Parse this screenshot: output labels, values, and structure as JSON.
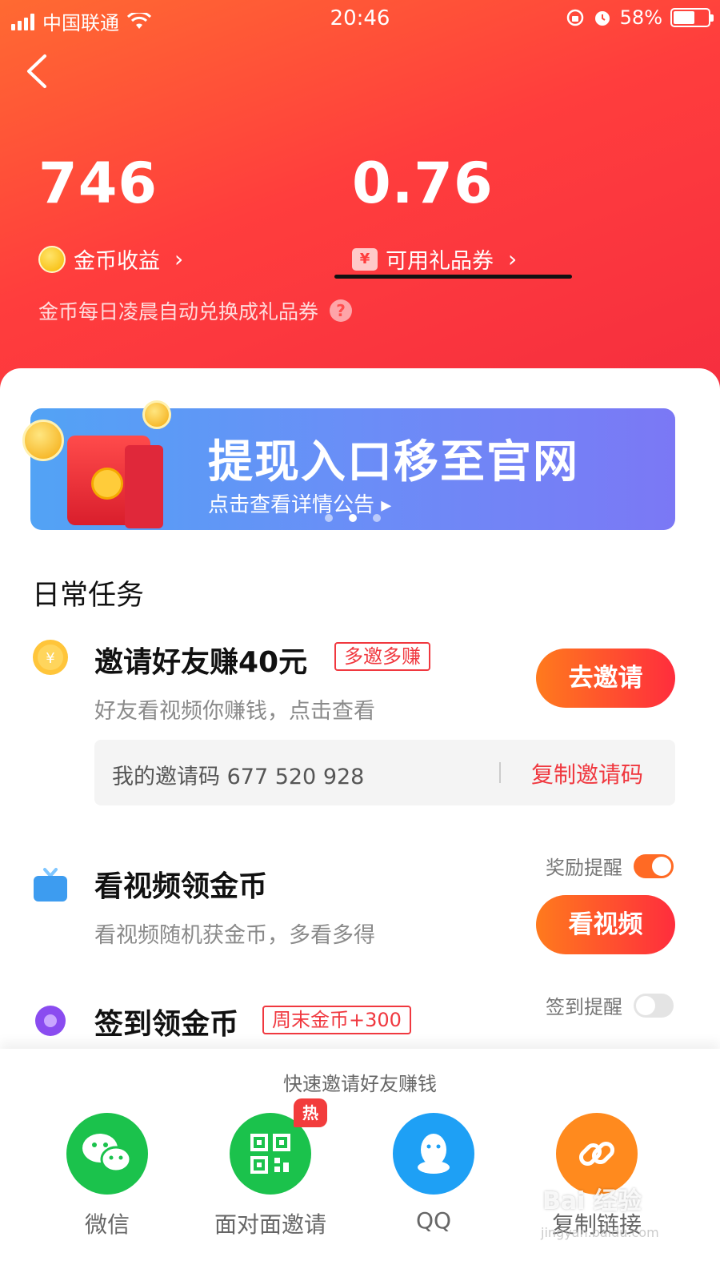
{
  "status_bar": {
    "carrier": "中国联通",
    "time": "20:46",
    "battery": "58%"
  },
  "header": {
    "coins": {
      "value": "746",
      "label": "金币收益"
    },
    "vouchers": {
      "value": "0.76",
      "label": "可用礼品券",
      "icon_text": "¥"
    },
    "hint": "金币每日凌晨自动兑换成礼品券",
    "hint_icon": "?"
  },
  "banner": {
    "title": "提现入口移至官网",
    "subtitle": "点击查看详情公告"
  },
  "tasks_section": {
    "title": "日常任务"
  },
  "tasks": {
    "invite": {
      "title": "邀请好友赚40元",
      "tag": "多邀多赚",
      "desc": "好友看视频你赚钱，点击查看",
      "button": "去邀请",
      "icon_text": "¥",
      "code_label": "我的邀请码 677 520 928",
      "copy": "复制邀请码"
    },
    "video": {
      "title": "看视频领金币",
      "desc": "看视频随机获金币，多看多得",
      "button": "看视频",
      "remind_label": "奖励提醒",
      "remind_on": true
    },
    "checkin": {
      "title": "签到领金币",
      "tag": "周末金币+300",
      "remind_label": "签到提醒",
      "remind_on": false
    }
  },
  "share": {
    "title": "快速邀请好友赚钱",
    "items": [
      {
        "label": "微信",
        "color": "#1bc24c",
        "icon": "wechat-icon"
      },
      {
        "label": "面对面邀请",
        "color": "#1bc24c",
        "icon": "qrcode-icon",
        "badge": "热"
      },
      {
        "label": "QQ",
        "color": "#1ea0f5",
        "icon": "qq-icon"
      },
      {
        "label": "复制链接",
        "color": "#ff8a1e",
        "icon": "link-icon"
      }
    ]
  },
  "watermark": {
    "text": "Bai 经验",
    "sub": "jingyan.baidu.com"
  }
}
